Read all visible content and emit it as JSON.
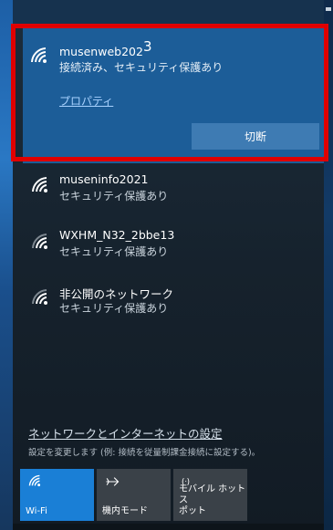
{
  "networks": {
    "connected": {
      "name": "musenweb202",
      "name_suffix": "3",
      "status": "接続済み、セキュリティ保護あり",
      "properties_label": "プロパティ",
      "disconnect_label": "切断"
    },
    "items": [
      {
        "name": "museninfo2021",
        "status": "セキュリティ保護あり"
      },
      {
        "name": "WXHM_N32_2bbe13",
        "status": "セキュリティ保護あり"
      },
      {
        "name": "非公開のネットワーク",
        "status": "セキュリティ保護あり"
      }
    ]
  },
  "settings": {
    "link_label": "ネットワークとインターネットの設定",
    "description": "設定を変更します (例: 接続を従量制課金接続に設定する)。"
  },
  "quick_actions": {
    "wifi": {
      "label": "Wi-Fi",
      "icon": "wifi-icon",
      "active": true
    },
    "airplane": {
      "label": "機内モード",
      "icon": "airplane-icon",
      "active": false
    },
    "hotspot": {
      "label_line1": "モバイル ホットス",
      "label_line2": "ポット",
      "icon": "hotspot-icon",
      "active": false
    }
  },
  "colors": {
    "accent": "#1a7fd6",
    "selected_bg": "#1c5d98",
    "highlight_border": "#e00000"
  }
}
